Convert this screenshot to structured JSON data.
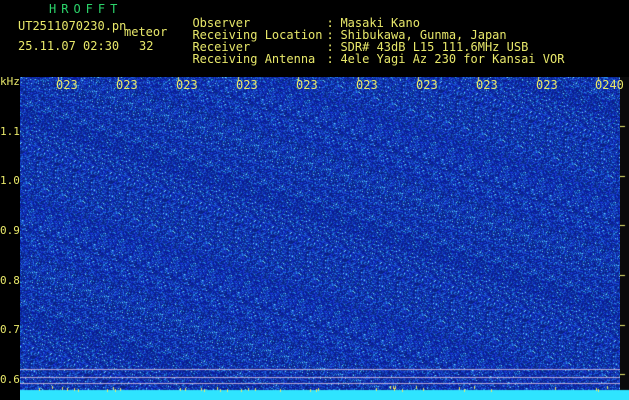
{
  "header": {
    "app_title": "HROFFT",
    "file_name": "UT2511070230.pn",
    "meteor_label": "meteor",
    "date_time": "25.11.07 02:30",
    "meteor_count": "32"
  },
  "meta": {
    "observer_key": "Observer",
    "observer_val": "Masaki Kano",
    "location_key": "Receiving Location",
    "location_val": "Shibukawa, Gunma, Japan",
    "receiver_key": "Receiver",
    "receiver_val": "SDR# 43dB L15 111.6MHz USB",
    "antenna_key": "Receiving Antenna",
    "antenna_val": "4ele Yagi Az 230 for Kansai VOR",
    "sep": ":"
  },
  "axis": {
    "unit": "kHz",
    "y_ticks": [
      "1.1",
      "1.0",
      "0.9",
      "0.8",
      "0.7",
      "0.6"
    ],
    "x_ticks": [
      "023",
      "023",
      "023",
      "023",
      "023",
      "023",
      "023",
      "023",
      "023",
      "0240"
    ]
  },
  "colors": {
    "background": "#000000",
    "spectrogram_base": "#1a2fae",
    "noise_dot": "#5fd0ff",
    "bottom_band": "#2fe4ff",
    "text": "#e8e86a",
    "title": "#2bd36a"
  }
}
